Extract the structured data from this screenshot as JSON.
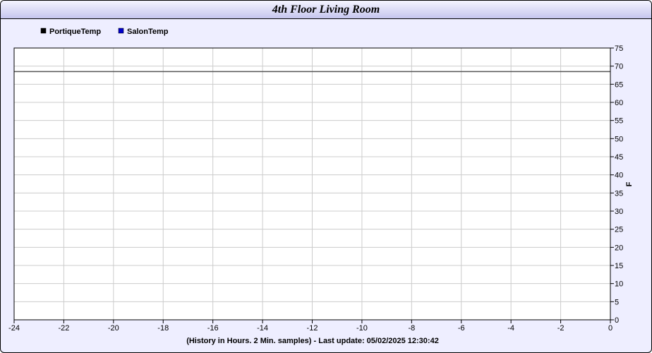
{
  "window": {
    "title": "4th Floor Living Room"
  },
  "chart_data": {
    "type": "line",
    "title": "4th Floor Living Room",
    "xlabel": "(History in Hours. 2 Min. samples) - Last update: 05/02/2025 12:30:42",
    "ylabel": "F",
    "xlim": [
      -24,
      0
    ],
    "ylim": [
      0,
      75
    ],
    "xticks": [
      -24,
      -22,
      -20,
      -18,
      -16,
      -14,
      -12,
      -10,
      -8,
      -6,
      -4,
      -2,
      0
    ],
    "yticks": [
      0,
      5,
      10,
      15,
      20,
      25,
      30,
      35,
      40,
      45,
      50,
      55,
      60,
      65,
      70,
      75
    ],
    "grid": true,
    "legend_position": "top-left",
    "series": [
      {
        "name": "PortiqueTemp",
        "color": "#000000",
        "x": [
          -24,
          0
        ],
        "y": [
          68.5,
          68.5
        ]
      },
      {
        "name": "SalonTemp",
        "color": "#0000cc",
        "x": [],
        "y": []
      }
    ]
  }
}
